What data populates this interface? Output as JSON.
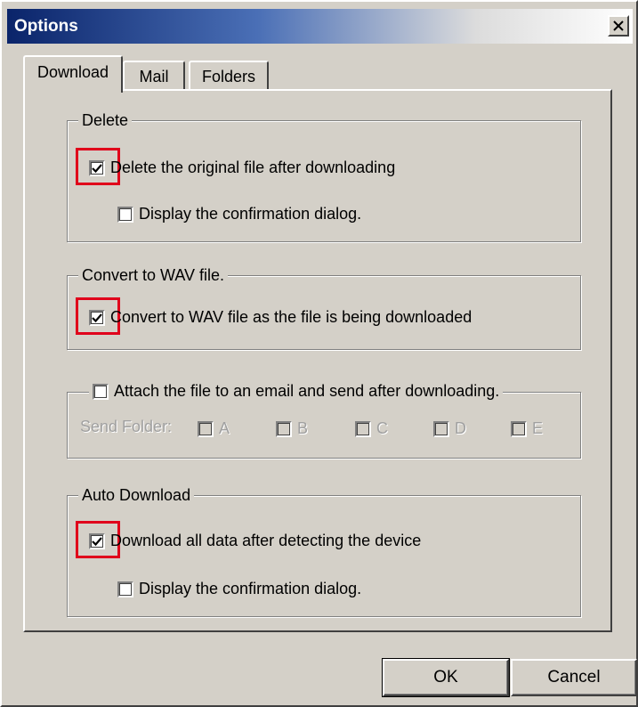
{
  "window": {
    "title": "Options",
    "close_label": "X"
  },
  "tabs": [
    {
      "label": "Download",
      "active": true
    },
    {
      "label": "Mail",
      "active": false
    },
    {
      "label": "Folders",
      "active": false
    }
  ],
  "delete_group": {
    "legend": "Delete",
    "delete_original": {
      "label": "Delete the original file after downloading",
      "checked": true
    },
    "confirm": {
      "label": "Display the confirmation dialog.",
      "checked": false
    }
  },
  "convert_group": {
    "legend": "Convert to WAV file.",
    "convert": {
      "label": "Convert to WAV file as the file is being downloaded",
      "checked": true
    }
  },
  "attach_group": {
    "attach": {
      "label": "Attach the file to an email and send after downloading.",
      "checked": false
    },
    "send_folder_label": "Send Folder:",
    "folders": [
      "A",
      "B",
      "C",
      "D",
      "E"
    ]
  },
  "auto_group": {
    "legend": "Auto Download",
    "download_all": {
      "label": "Download all data after detecting the device",
      "checked": true
    },
    "confirm": {
      "label": "Display the confirmation dialog.",
      "checked": false
    }
  },
  "buttons": {
    "ok": "OK",
    "cancel": "Cancel"
  },
  "colors": {
    "highlight": "#e0001b",
    "title_bar": "#0a246a",
    "face": "#d4d0c8"
  }
}
